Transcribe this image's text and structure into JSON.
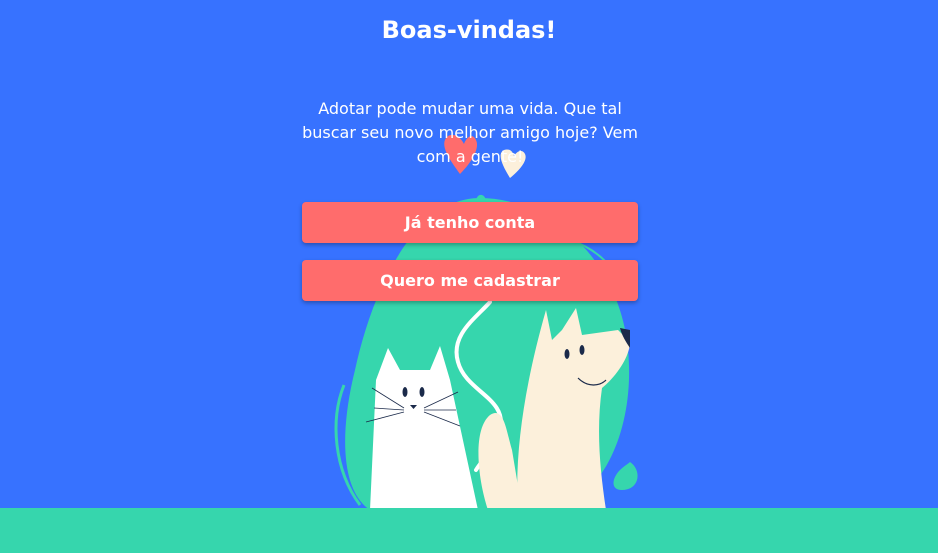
{
  "header": {
    "title": "Boas-vindas!"
  },
  "main": {
    "description": "Adotar pode mudar uma vida. Que tal buscar seu novo melhor amigo hoje? Vem com a gente!",
    "login_label": "Já tenho conta",
    "signup_label": "Quero me cadastrar"
  },
  "colors": {
    "background": "#3772FF",
    "accent": "#FF6C6C",
    "green": "#36D6AD",
    "cream": "#FCF0DB"
  },
  "illustration": {
    "icons": [
      "heart-red-icon",
      "heart-cream-icon",
      "cat-icon",
      "dog-icon"
    ]
  }
}
